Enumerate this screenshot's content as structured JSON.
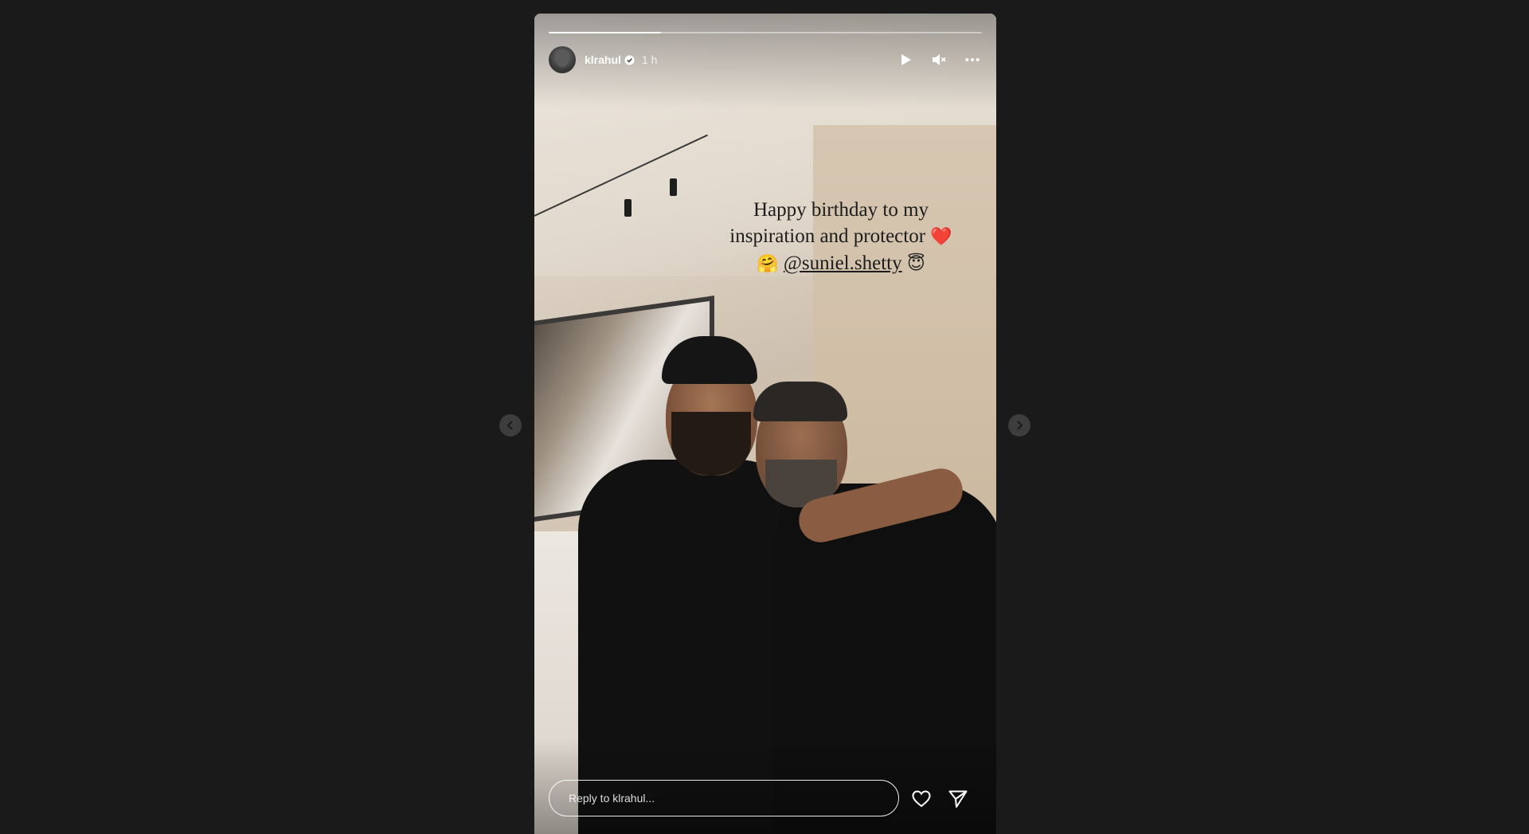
{
  "story": {
    "username": "klrahul",
    "timestamp": "1 h",
    "progress": 0.26,
    "caption": {
      "line1": "Happy birthday to my",
      "line2": "inspiration and protector",
      "line2_emoji": "❤️",
      "line3_emoji_before": "🤗",
      "mention": "@suniel.shetty",
      "line3_emoji_after": "😇"
    }
  },
  "reply": {
    "placeholder": "Reply to klrahul..."
  },
  "icons": {
    "play": "play-icon",
    "mute": "speaker-muted-icon",
    "more": "more-horizontal-icon",
    "like": "heart-icon",
    "share": "send-icon",
    "prev": "chevron-left-icon",
    "next": "chevron-right-icon"
  },
  "colors": {
    "background": "#1a1a1a",
    "text_light": "#ffffff"
  }
}
